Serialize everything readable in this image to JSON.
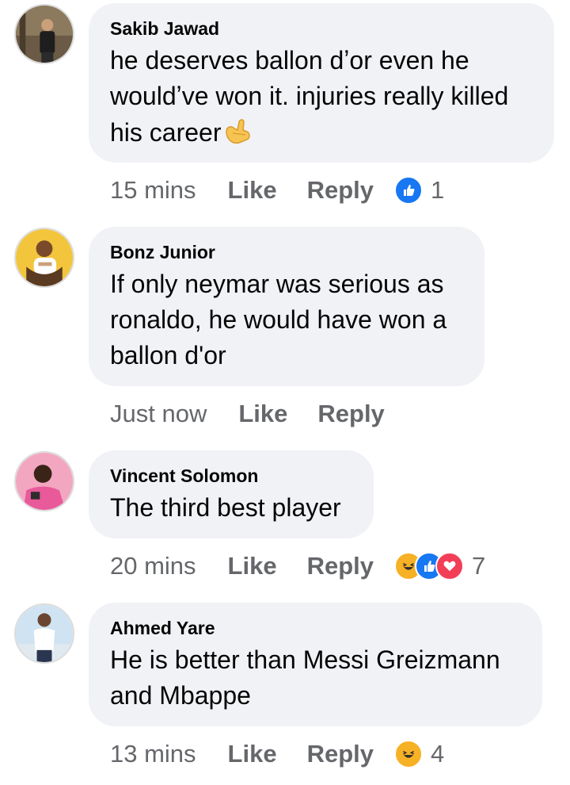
{
  "comments": [
    {
      "author": "Sakib Jawad",
      "text": "he deserves ballon dʼor even he wouldʼve won it. injuries really killed his career",
      "time": "15 mins",
      "like_label": "Like",
      "reply_label": "Reply",
      "reactions": [
        "like-icon"
      ],
      "reaction_count": "1",
      "inline_emoji": "call-me-hand-emoji"
    },
    {
      "author": "Bonz Junior",
      "text": "If only neymar was serious as ronaldo, he would have won a ballon d'or",
      "time": "Just now",
      "like_label": "Like",
      "reply_label": "Reply",
      "reactions": [],
      "reaction_count": ""
    },
    {
      "author": "Vincent Solomon",
      "text": "The third best player",
      "time": "20 mins",
      "like_label": "Like",
      "reply_label": "Reply",
      "reactions": [
        "haha-icon",
        "like-icon",
        "love-icon"
      ],
      "reaction_count": "7"
    },
    {
      "author": "Ahmed Yare",
      "text": "He is better than Messi Greizmann and Mbappe",
      "time": "13 mins",
      "like_label": "Like",
      "reply_label": "Reply",
      "reactions": [
        "haha-icon"
      ],
      "reaction_count": "4"
    }
  ],
  "colors": {
    "bubble": "#f0f2f5",
    "meta_text": "#65676b",
    "like_blue": "#1877f2",
    "love_red": "#f33e58",
    "haha_yellow": "#f7b125"
  }
}
